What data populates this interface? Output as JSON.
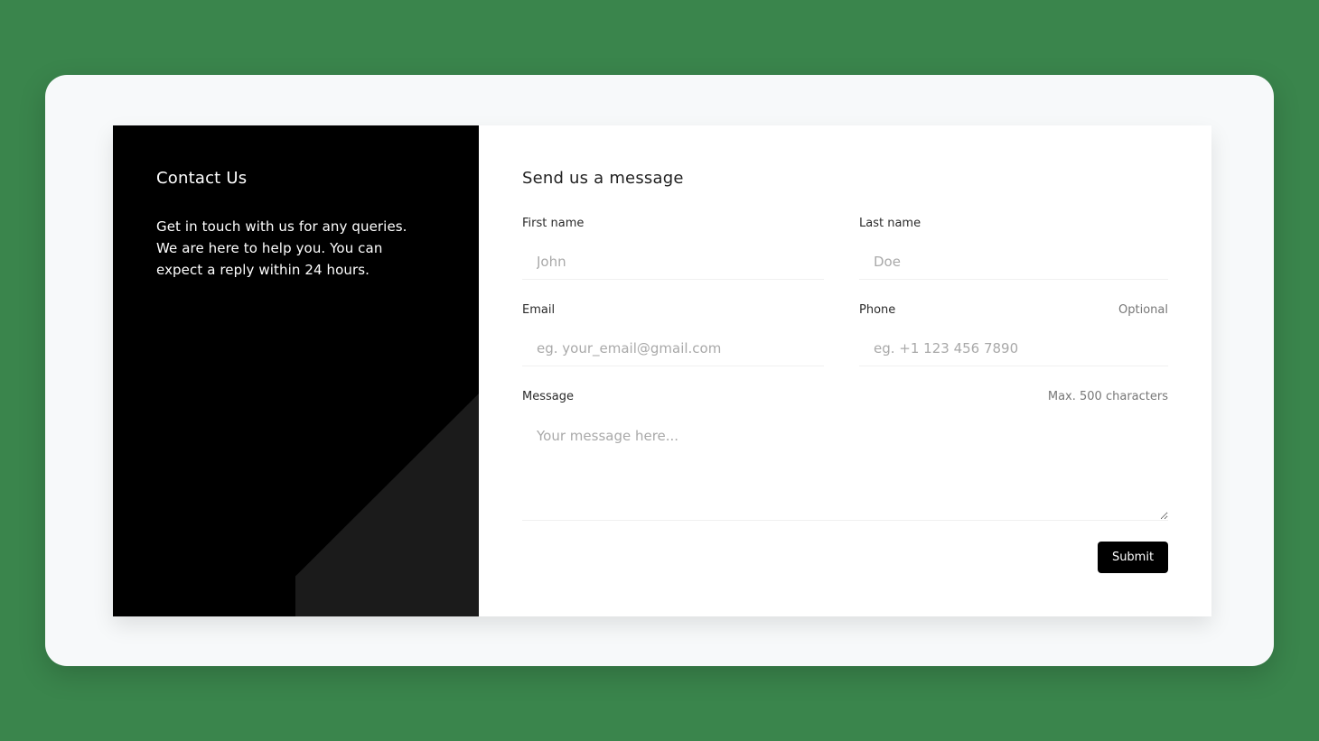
{
  "info": {
    "title": "Contact Us",
    "description": "Get in touch with us for any queries. We are here to help you. You can expect a reply within 24 hours."
  },
  "form": {
    "title": "Send us a message",
    "first_name": {
      "label": "First name",
      "placeholder": "John"
    },
    "last_name": {
      "label": "Last name",
      "placeholder": "Doe"
    },
    "email": {
      "label": "Email",
      "placeholder": "eg. your_email@gmail.com"
    },
    "phone": {
      "label": "Phone",
      "hint": "Optional",
      "placeholder": "eg. +1 123 456 7890"
    },
    "message": {
      "label": "Message",
      "hint": "Max. 500 characters",
      "placeholder": "Your message here..."
    },
    "submit_label": "Submit"
  },
  "colors": {
    "page_background": "#3a854c",
    "frame_background": "#f7f9fa",
    "left_panel": "#000000",
    "button": "#000000"
  }
}
